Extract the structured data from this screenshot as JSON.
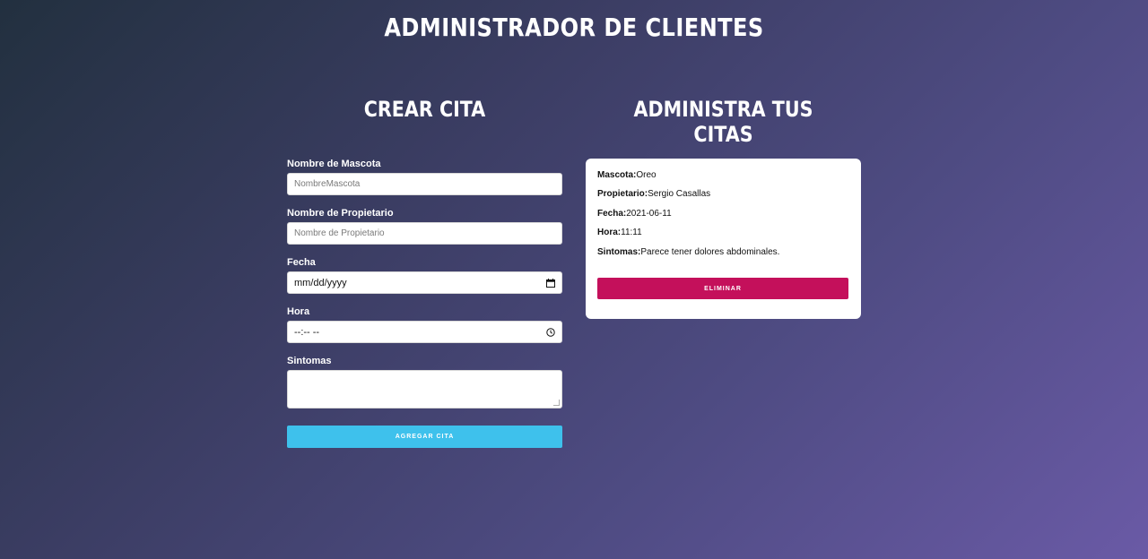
{
  "header": {
    "title": "ADMINISTRADOR DE CLIENTES"
  },
  "form_section": {
    "title": "CREAR CITA",
    "fields": {
      "mascota": {
        "label": "Nombre de Mascota",
        "placeholder": "NombreMascota",
        "value": ""
      },
      "propietario": {
        "label": "Nombre de Propietario",
        "placeholder": "Nombre de Propietario",
        "value": ""
      },
      "fecha": {
        "label": "Fecha",
        "placeholder": "mm/dd/yyyy",
        "icon": "calendar-icon"
      },
      "hora": {
        "label": "Hora",
        "placeholder": "--:-- --",
        "icon": "clock-icon"
      },
      "sintomas": {
        "label": "Sintomas",
        "value": ""
      }
    },
    "submit_label": "AGREGAR CITA",
    "submit_color": "#3ec1ec"
  },
  "list_section": {
    "title": "ADMINISTRA TUS CITAS",
    "appointments": [
      {
        "mascota_key": "Mascota:",
        "mascota": "Oreo",
        "propietario_key": "Propietario:",
        "propietario": "Sergio Casallas",
        "fecha_key": "Fecha:",
        "fecha": "2021-06-11",
        "hora_key": "Hora:",
        "hora": "11:11",
        "sintomas_key": "Sintomas:",
        "sintomas": "Parece tener dolores abdominales.",
        "delete_label": "ELIMINAR"
      }
    ],
    "delete_color": "#c4105b"
  }
}
